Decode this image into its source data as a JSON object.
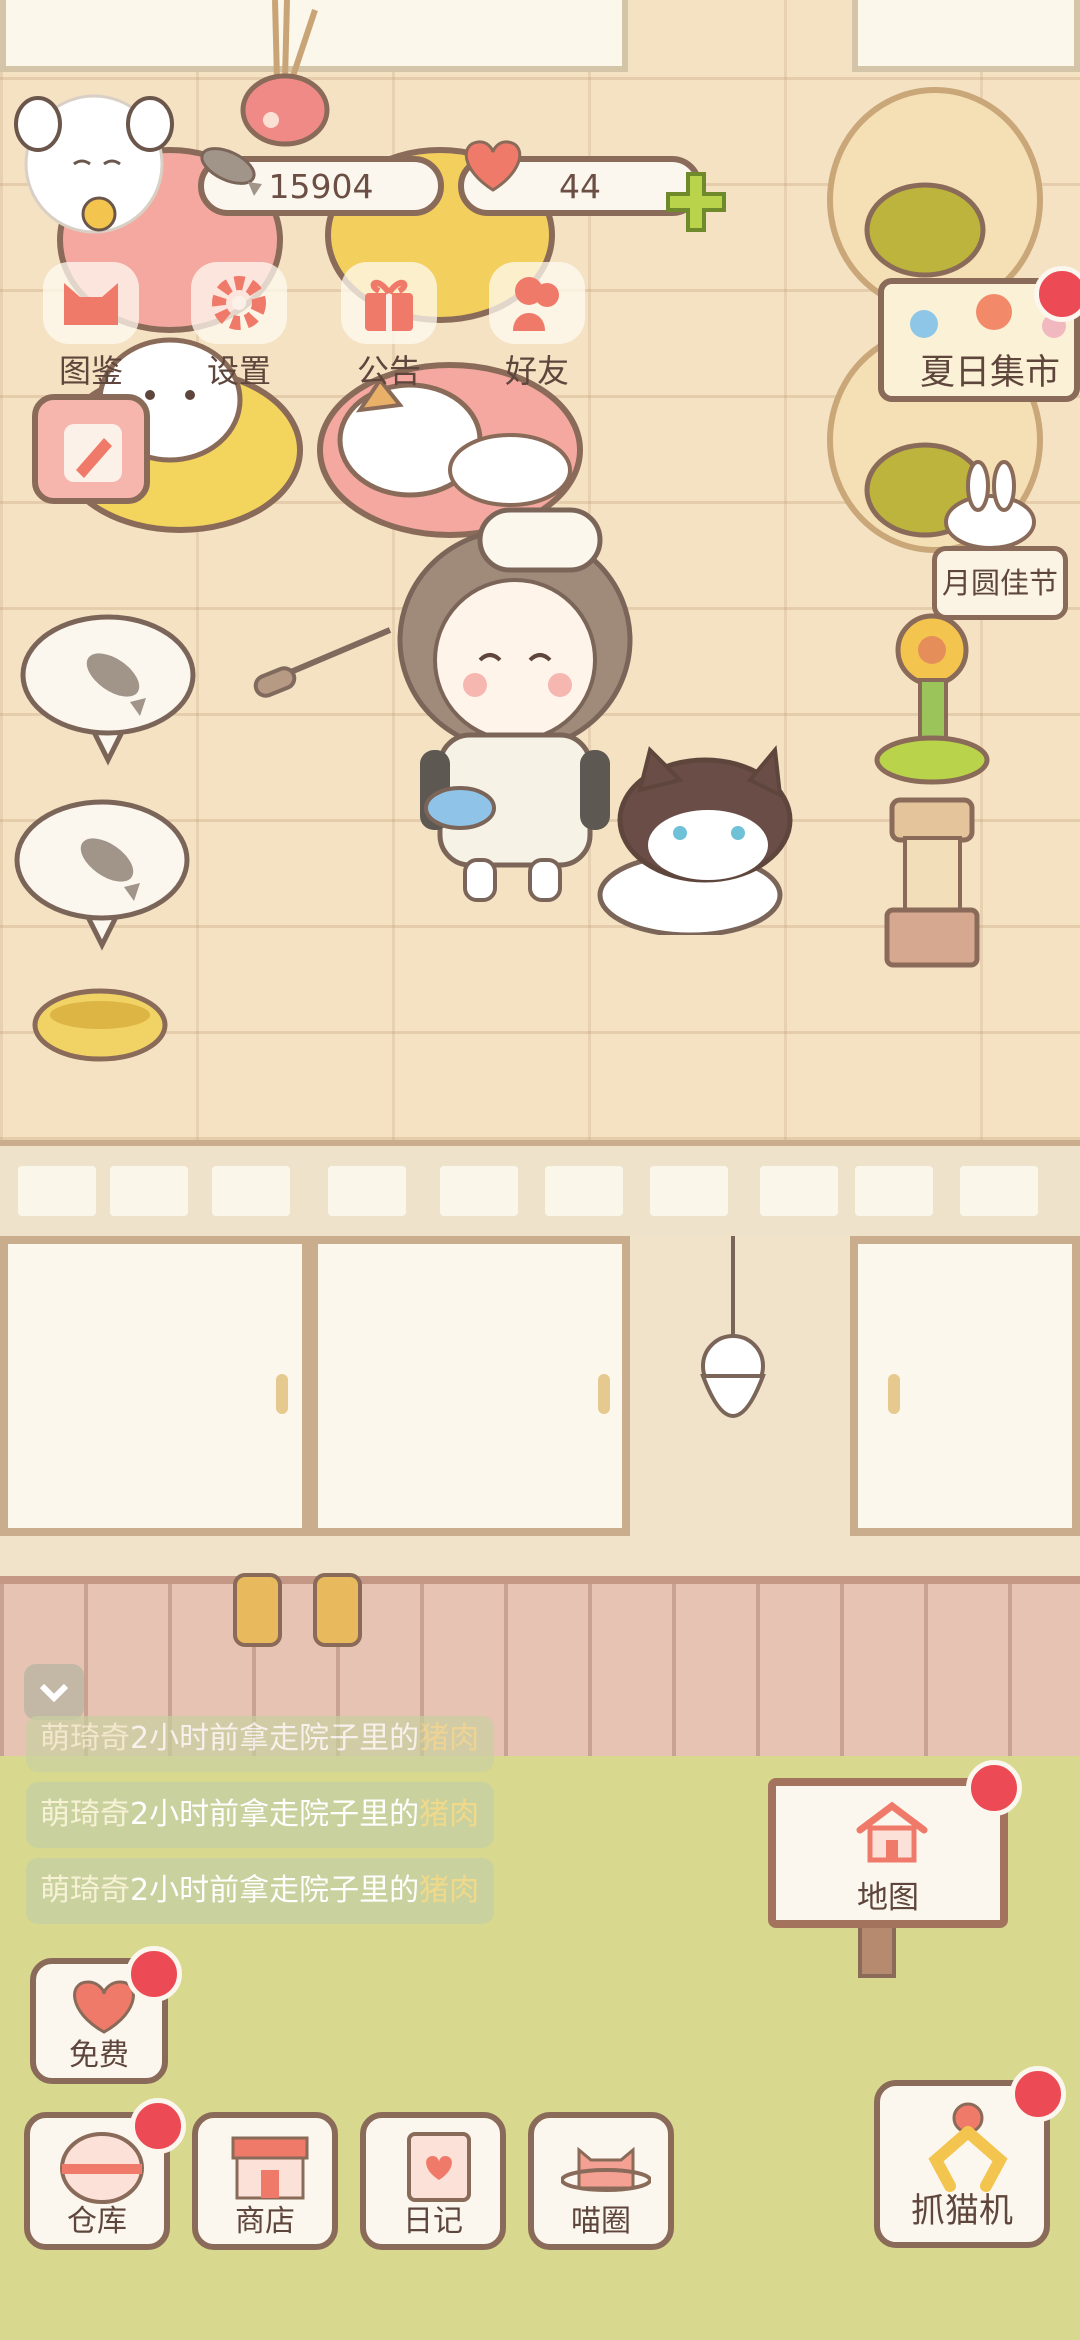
{
  "hud": {
    "fish_count": "15904",
    "heart_count": "44",
    "buttons": [
      {
        "label": "图鉴",
        "icon": "cat-head-icon"
      },
      {
        "label": "设置",
        "icon": "gear-icon"
      },
      {
        "label": "公告",
        "icon": "gift-icon"
      },
      {
        "label": "好友",
        "icon": "friends-icon"
      }
    ]
  },
  "events": {
    "summer_market": "夏日集市",
    "mid_autumn": "月圆佳节"
  },
  "activity_log": [
    {
      "name": "萌琦奇",
      "text": "2小时前拿走院子里的",
      "item": "猪肉"
    },
    {
      "name": "萌琦奇",
      "text": "2小时前拿走院子里的",
      "item": "猪肉"
    },
    {
      "name": "萌琦奇",
      "text": "2小时前拿走院子里的",
      "item": "猪肉"
    }
  ],
  "map_sign": {
    "label": "地图"
  },
  "bottom_bar": {
    "free": "免费",
    "warehouse": "仓库",
    "shop": "商店",
    "diary": "日记",
    "meow_circle": "喵圈",
    "claw_machine": "抓猫机"
  },
  "colors": {
    "accent_red": "#ec4a54",
    "coral": "#f07a6a",
    "outline": "#8a6a58",
    "lime": "#b9d44a"
  }
}
